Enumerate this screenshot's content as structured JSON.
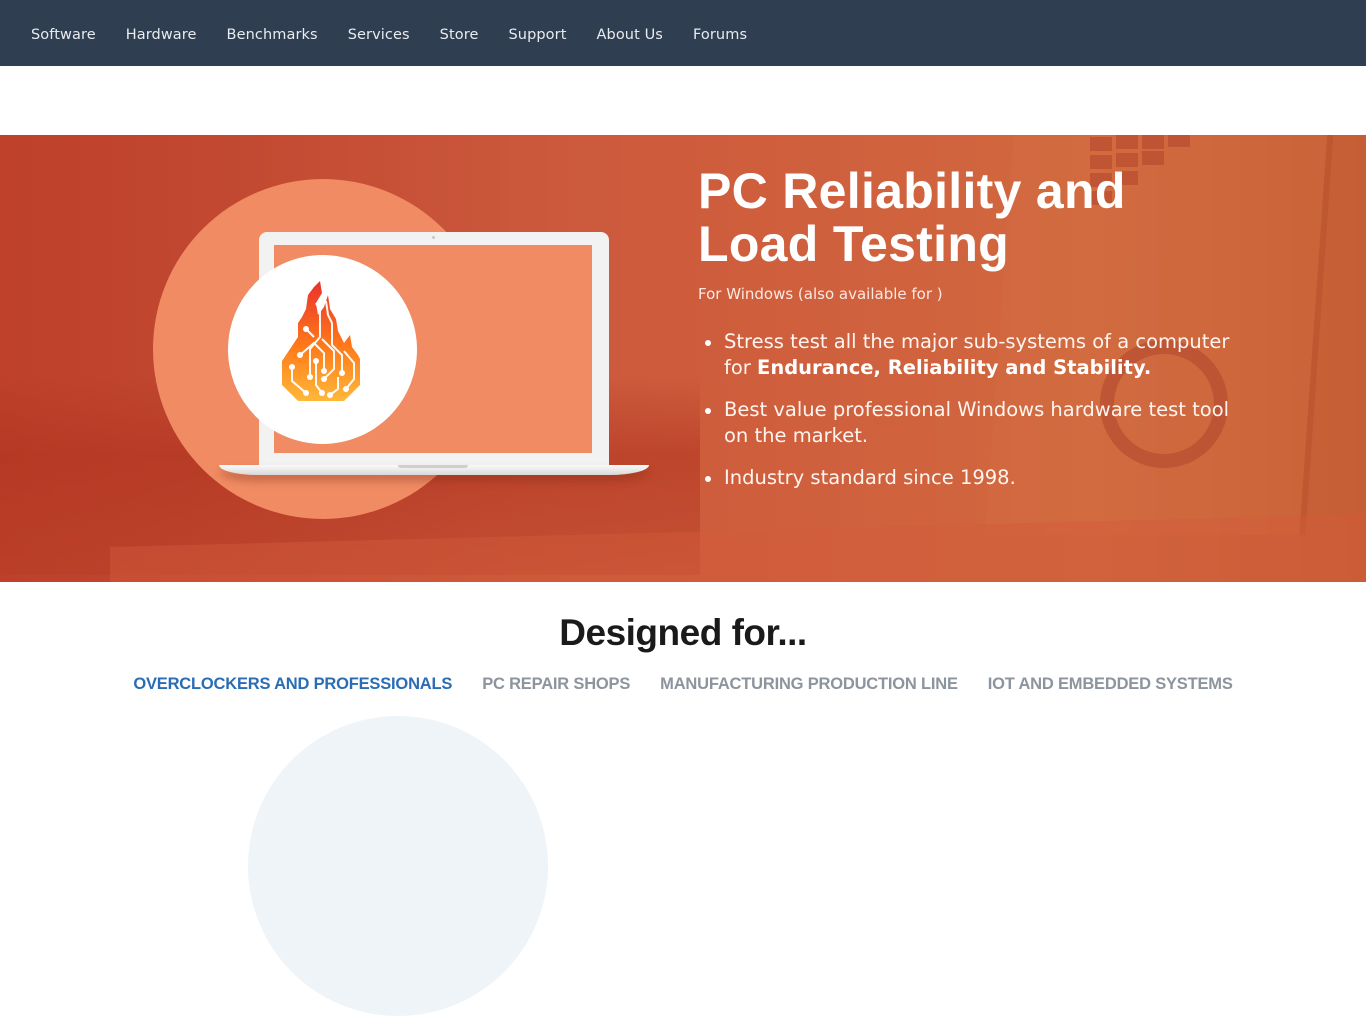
{
  "nav": {
    "items": [
      {
        "label": "Software"
      },
      {
        "label": "Hardware"
      },
      {
        "label": "Benchmarks"
      },
      {
        "label": "Services"
      },
      {
        "label": "Store"
      },
      {
        "label": "Support"
      },
      {
        "label": "About Us"
      },
      {
        "label": "Forums"
      }
    ]
  },
  "hero": {
    "title_line1": "PC Reliability and",
    "title_line2": "Load Testing",
    "subtitle": "For Windows (also available for )",
    "bullets": [
      {
        "text": "Stress test all the major sub-systems of a computer for ",
        "bold": "Endurance, Reliability and Stability."
      },
      {
        "text": "Best value professional Windows hardware test tool on the market.",
        "bold": ""
      },
      {
        "text": "Industry standard since 1998.",
        "bold": ""
      }
    ],
    "logo_icon": "circuit-flame-icon",
    "colors": {
      "background": "#c9553a",
      "circle": "#f08b63",
      "logo_top": "#e8322c",
      "logo_bottom": "#ffb83a"
    }
  },
  "designed": {
    "heading": "Designed for...",
    "tabs": [
      {
        "label": "OVERCLOCKERS AND PROFESSIONALS",
        "active": true
      },
      {
        "label": "PC REPAIR SHOPS",
        "active": false
      },
      {
        "label": "MANUFACTURING PRODUCTION LINE",
        "active": false
      },
      {
        "label": "IOT AND EMBEDDED SYSTEMS",
        "active": false
      }
    ],
    "colors": {
      "active": "#2a6db5",
      "inactive": "#8c949e"
    }
  },
  "theme": {
    "nav_bg": "#2f3e50"
  }
}
